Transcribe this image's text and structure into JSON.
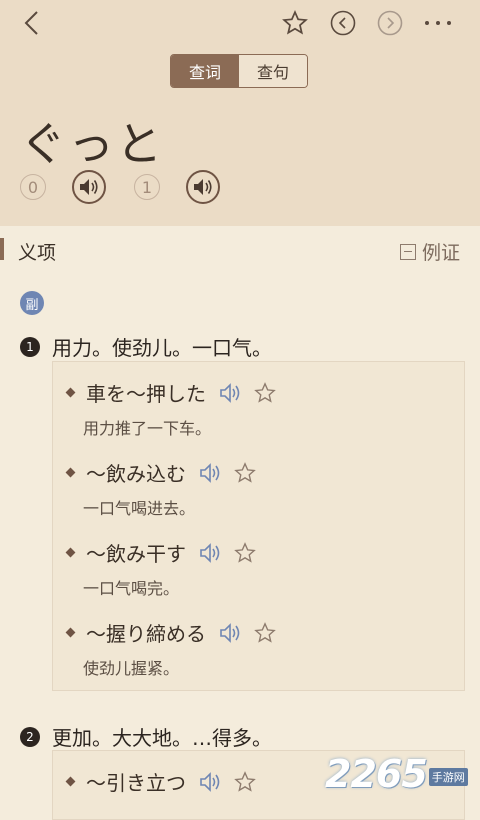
{
  "header": {
    "tabs": [
      {
        "label": "查词",
        "active": true
      },
      {
        "label": "查句",
        "active": false
      }
    ]
  },
  "entry": {
    "headword": "ぐっと",
    "pronunciations": [
      {
        "index": "0"
      },
      {
        "index": "1"
      }
    ]
  },
  "section": {
    "title": "义项",
    "example_toggle_label": "例证"
  },
  "pos_badge": "副",
  "senses": [
    {
      "number": "1",
      "definition": "用力。使劲儿。一口气。",
      "examples": [
        {
          "jp": "車を～押した",
          "cn": "用力推了一下车。"
        },
        {
          "jp": "～飲み込む",
          "cn": "一口气喝进去。"
        },
        {
          "jp": "～飲み干す",
          "cn": "一口气喝完。"
        },
        {
          "jp": "～握り締める",
          "cn": "使劲儿握紧。"
        }
      ]
    },
    {
      "number": "2",
      "definition": "更加。大大地。…得多。",
      "examples": [
        {
          "jp": "～引き立つ",
          "cn": ""
        }
      ]
    }
  ],
  "watermark": {
    "number": "2265",
    "sub": "手游网"
  },
  "colors": {
    "header_bg": "#ebdcc6",
    "page_bg": "#f4ecdc",
    "accent": "#8b6b55",
    "speaker_blue": "#6f86b3"
  }
}
